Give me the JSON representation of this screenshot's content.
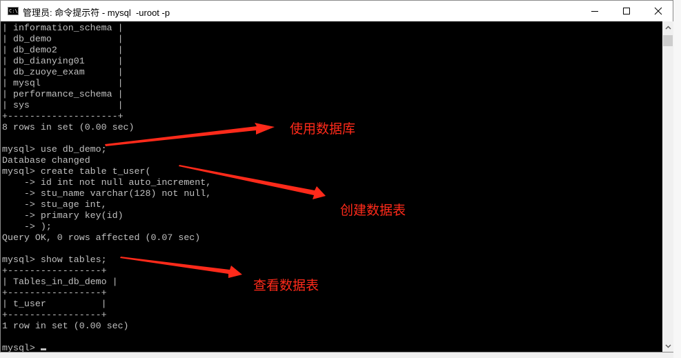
{
  "window": {
    "title": "管理员: 命令提示符 - mysql  -uroot -p",
    "app_icon_label": "C:\\",
    "controls": [
      "minimize",
      "maximize",
      "close"
    ]
  },
  "console": {
    "lines": [
      "| information_schema |",
      "| db_demo            |",
      "| db_demo2           |",
      "| db_dianying01      |",
      "| db_zuoye_exam      |",
      "| mysql              |",
      "| performance_schema |",
      "| sys                |",
      "+--------------------+",
      "8 rows in set (0.00 sec)",
      "",
      "mysql> use db_demo;",
      "Database changed",
      "mysql> create table t_user(",
      "    -> id int not null auto_increment,",
      "    -> stu_name varchar(128) not null,",
      "    -> stu_age int,",
      "    -> primary key(id)",
      "    -> );",
      "Query OK, 0 rows affected (0.07 sec)",
      "",
      "mysql> show tables;",
      "+-----------------+",
      "| Tables_in_db_demo |",
      "+-----------------+",
      "| t_user          |",
      "+-----------------+",
      "1 row in set (0.00 sec)",
      "",
      "mysql> "
    ]
  },
  "annotations": [
    {
      "text": "使用数据库",
      "target": "use db_demo;"
    },
    {
      "text": "创建数据表",
      "target": "create table t_user("
    },
    {
      "text": "查看数据表",
      "target": "show tables;"
    }
  ],
  "colors": {
    "console_bg": "#000000",
    "console_fg": "#c0c0c0",
    "annotation": "#ff2a1a"
  }
}
